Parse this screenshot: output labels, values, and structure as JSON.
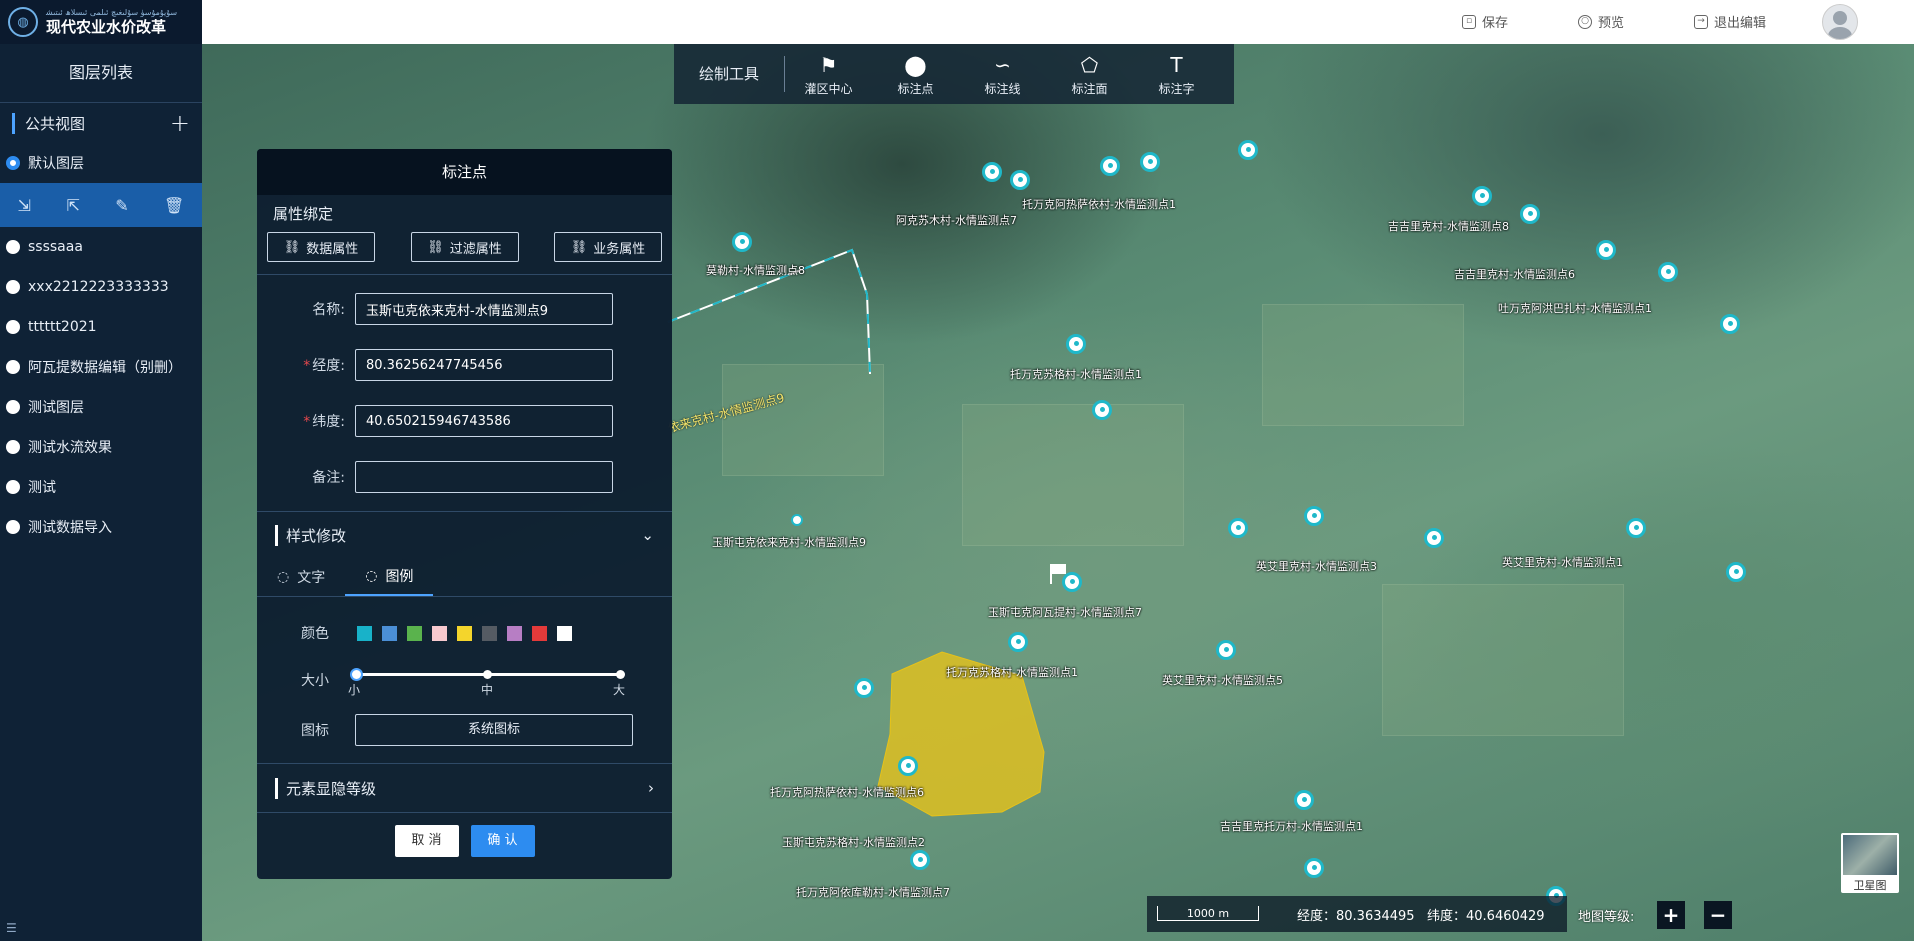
{
  "app": {
    "logo_sub": "ﺳﯘﻳﯘﻣﯘﺳﯜ ﺳﯘﻟﯩﻐﯩﭻ ﺋﯩﻠﻤﻰ ﺋﯩﺴﻼﮪ ﺋﯩﺘﯩﺸ",
    "logo_main": "现代农业水价改革"
  },
  "topbar": {
    "save": "保存",
    "preview": "预览",
    "exit": "退出编辑"
  },
  "sidebar": {
    "title": "图层列表",
    "section": "公共视图",
    "add": "+",
    "layers": [
      {
        "label": "默认图层",
        "selected": true
      },
      {
        "label": "ssssaaa",
        "selected": false
      },
      {
        "label": "xxx2212223333333",
        "selected": false
      },
      {
        "label": "tttttt2021",
        "selected": false
      },
      {
        "label": "阿瓦提数据编辑（别删）",
        "selected": false
      },
      {
        "label": "测试图层",
        "selected": false
      },
      {
        "label": "测试水流效果",
        "selected": false
      },
      {
        "label": "测试",
        "selected": false
      },
      {
        "label": "测试数据导入",
        "selected": false
      }
    ],
    "bottom_icon": "☰"
  },
  "toolbar": {
    "label": "绘制工具",
    "tools": [
      {
        "label": "灌区中心",
        "icon": "flag-icon"
      },
      {
        "label": "标注点",
        "icon": "pin-icon"
      },
      {
        "label": "标注线",
        "icon": "line-icon"
      },
      {
        "label": "标注面",
        "icon": "polygon-icon"
      },
      {
        "label": "标注字",
        "icon": "text-icon"
      }
    ]
  },
  "panel": {
    "title": "标注点",
    "attr_section": "属性绑定",
    "attr_buttons": [
      "数据属性",
      "过滤属性",
      "业务属性"
    ],
    "fields": {
      "name_label": "名称:",
      "name_value": "玉斯屯克依来克村-水情监测点9",
      "lng_label": "经度:",
      "lng_value": "80.36256247745456",
      "lat_label": "纬度:",
      "lat_value": "40.650215946743586",
      "note_label": "备注:",
      "note_value": ""
    },
    "style_section": "样式修改",
    "tabs": [
      "文字",
      "图例"
    ],
    "color_label": "颜色",
    "colors": [
      "#18b2c9",
      "#4b8fd6",
      "#5ab34d",
      "#f7c9cf",
      "#f4d52c",
      "#555b63",
      "#b77ec4",
      "#e43a3a",
      "#ffffff"
    ],
    "size_label": "大小",
    "size_ticks": [
      "小",
      "中",
      "大"
    ],
    "icon_label": "图标",
    "icon_button": "系统图标",
    "visibility_section": "元素显隐等级",
    "cancel": "取 消",
    "confirm": "确 认"
  },
  "map": {
    "labels": [
      "莫勒村-水情监测点8",
      "阿克苏木村-水情监测点7",
      "托万克阿热萨依村-水情监测点1",
      "吉吉里克村-水情监测点8",
      "吉吉里克村-水情监测点6",
      "吐万克阿洪巴扎村-水情监测点1",
      "托万克苏格村-水情监测点1",
      "玉斯屯克依来克村-水情监测点9",
      "玉斯屯克阿瓦提村-水情监测点7",
      "托万克苏格村-水情监测点1",
      "英艾里克村-水情监测点1",
      "英艾里克村-水情监测点5",
      "英艾里克村-水情监测点3",
      "托万克阿热萨依村-水情监测点6",
      "玉斯屯克苏格村-水情监测点2",
      "托万克阿依库勒村-水情监测点7",
      "吉吉里克托万村-水情监测点1"
    ],
    "geo_label": "依来克村-水情监测点9",
    "scale": "1000 m",
    "lng_readout": "经度：80.3634495",
    "lat_readout": "纬度：40.6460429",
    "zoom_label": "地图等级:",
    "zoom_in": "+",
    "zoom_out": "−",
    "basemap": "卫星图"
  }
}
